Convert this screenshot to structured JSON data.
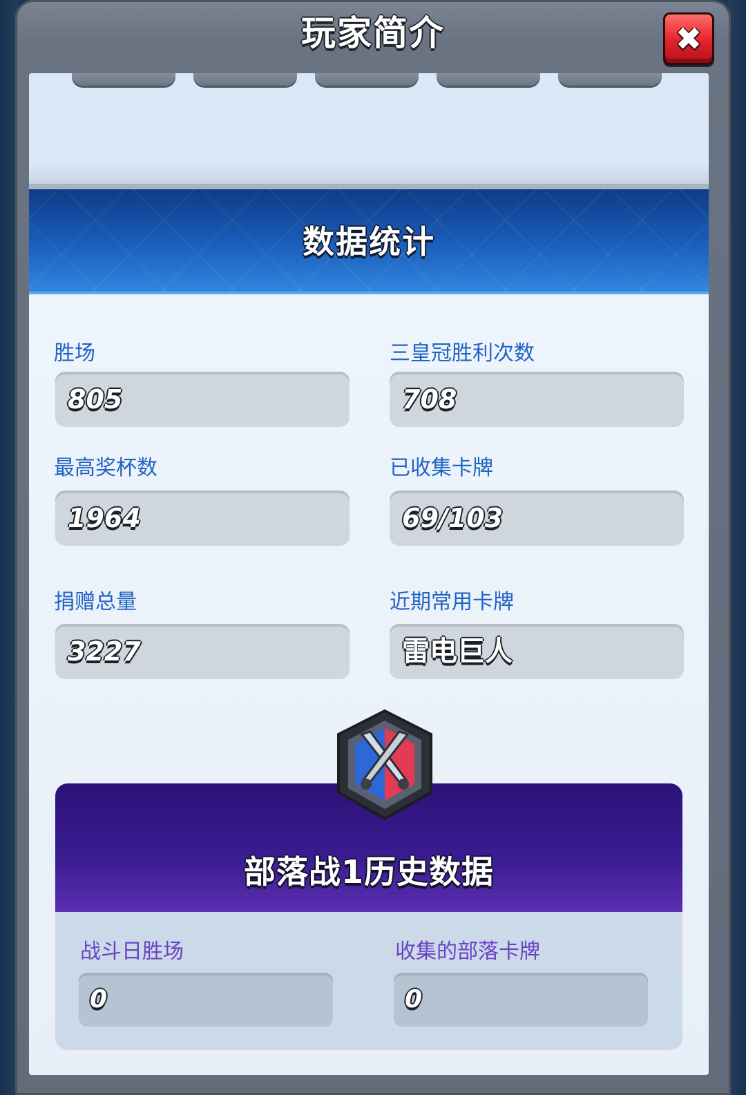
{
  "header": {
    "title": "玩家简介",
    "close_icon": "close-x-icon"
  },
  "stats_section": {
    "title": "数据统计",
    "items": [
      {
        "label": "胜场",
        "value": "805"
      },
      {
        "label": "三皇冠胜利次数",
        "value": "708"
      },
      {
        "label": "最高奖杯数",
        "value": "1964"
      },
      {
        "label": "已收集卡牌",
        "value": "69/103"
      },
      {
        "label": "捐赠总量",
        "value": "3227"
      },
      {
        "label": "近期常用卡牌",
        "value": "雷电巨人"
      }
    ]
  },
  "clan_war": {
    "title": "部落战1历史数据",
    "badge_icon": "crossed-swords-shield-icon",
    "items": [
      {
        "label": "战斗日胜场",
        "value": "0"
      },
      {
        "label": "收集的部落卡牌",
        "value": "0"
      }
    ]
  },
  "colors": {
    "label_blue": "#1f63c4",
    "label_purple": "#6a43c4",
    "banner_blue": "#1a5bb8",
    "war_purple": "#3b1d92",
    "close_red": "#e3232b"
  }
}
